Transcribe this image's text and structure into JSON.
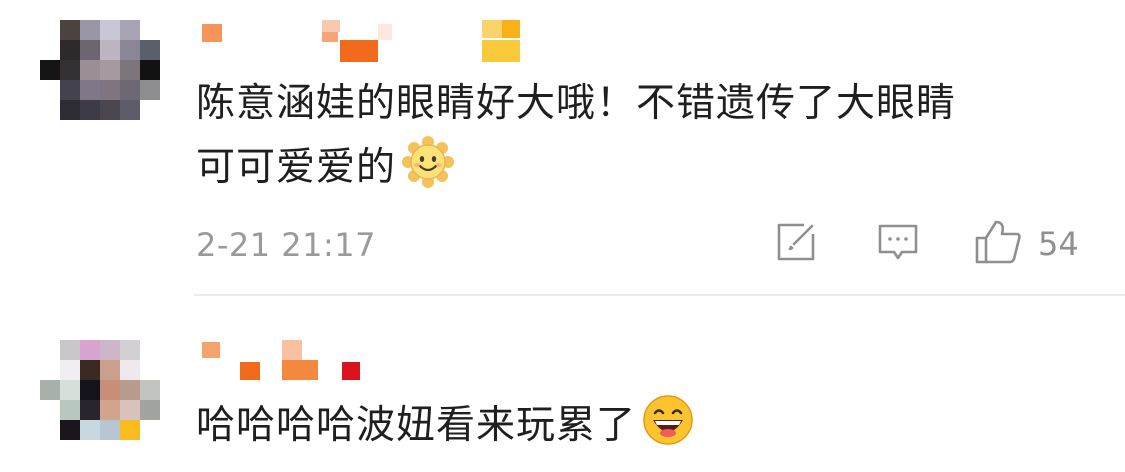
{
  "comments": [
    {
      "text_line1": "陈意涵娃的眼睛好大哦！不错遗传了大眼睛",
      "text_line2": "可可爱爱的",
      "emoji_icon": "sun-face-emoji",
      "timestamp": "2-21 21:17",
      "like_count": "54",
      "actions": [
        "share-icon",
        "comment-icon",
        "like-icon"
      ]
    },
    {
      "text_line1": "哈哈哈哈波妞看来玩累了",
      "emoji_icon": "laughing-face-emoji"
    }
  ],
  "colors": {
    "text": "#1f1f1f",
    "meta": "#9a9a9a",
    "divider": "#ececec",
    "username_orange": "#f26b1d",
    "username_yellow": "#f7b21a",
    "username_red": "#d9141f"
  }
}
